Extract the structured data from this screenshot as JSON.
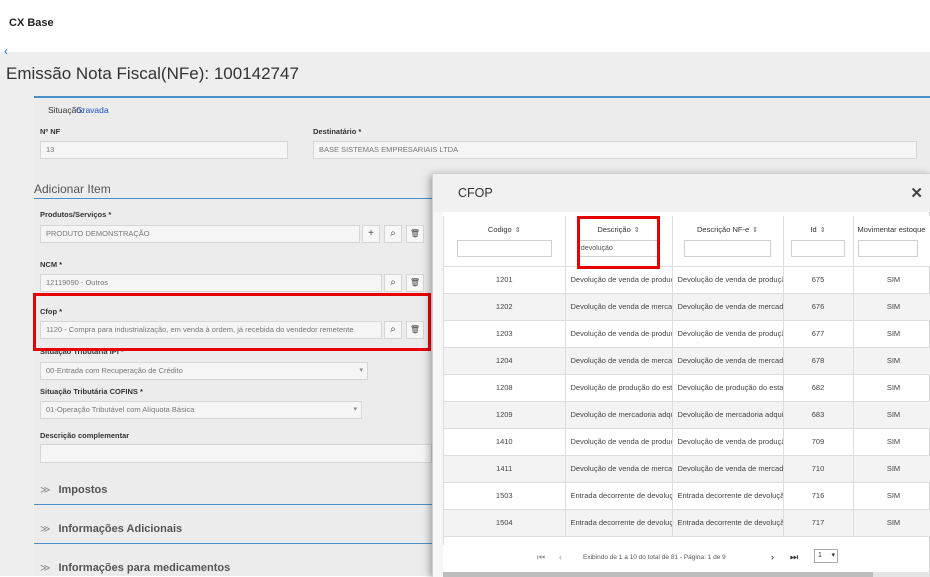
{
  "app": {
    "title": "CX Base",
    "back_glyph": "‹"
  },
  "page": {
    "title": "Emissão Nota Fiscal(NFe): 100142747"
  },
  "form": {
    "situacao_label": "Situação:",
    "situacao_value": "Gravada",
    "nf_label": "Nº NF",
    "nf_value": "13",
    "destinatario_label": "Destinatário *",
    "destinatario_value": "BASE SISTEMAS EMPRESARIAIS LTDA",
    "adicionar_item": "Adicionar Item",
    "produtos_label": "Produtos/Serviços *",
    "produtos_value": "PRODUTO DEMONSTRAÇÃO",
    "ncm_label": "NCM *",
    "ncm_value": "12119090 - Outros",
    "cfop_label": "Cfop *",
    "cfop_value": "1120 - Compra para industrialização, em venda à ordem, já recebida do vendedor remetente",
    "ipi_label": "Situação Tributária IPI *",
    "ipi_value": "00-Entrada com Recuperação de Crédito",
    "cofins_label": "Situação Tributária COFINS *",
    "cofins_value": "01-Operação Tributável com Alíquota Básica",
    "descricao_label": "Descrição complementar",
    "descricao_value": "",
    "sections": [
      "Impostos",
      "Informações Adicionais",
      "Informações para medicamentos"
    ]
  },
  "icons": {
    "plus": "+",
    "search": "⌕",
    "trash": "🗑",
    "chevron_section": "≫",
    "caret_down": "▾",
    "sort": "⇕"
  },
  "modal": {
    "title": "CFOP",
    "close_glyph": "✕",
    "columns": [
      "Codigo",
      "Descrição",
      "Descrição NF-e",
      "Id",
      "Movimentar estoque"
    ],
    "filters": [
      "",
      "devolução",
      "",
      "",
      ""
    ],
    "rows": [
      [
        "1201",
        "Devolução de venda de produção do estabelecimento",
        "Devolução de venda de produção do estabelecimento",
        "675",
        "SIM"
      ],
      [
        "1202",
        "Devolução de venda de mercadoria adquirida",
        "Devolução de venda de mercadoria adquirida",
        "676",
        "SIM"
      ],
      [
        "1203",
        "Devolução de venda de produção do estabelecimento",
        "Devolução de venda de produção do estabelecimento",
        "677",
        "SIM"
      ],
      [
        "1204",
        "Devolução de venda de mercadoria adquirida",
        "Devolução de venda de mercadoria adquirida",
        "678",
        "SIM"
      ],
      [
        "1208",
        "Devolução de produção do estabelecimento",
        "Devolução de produção do estabelecimento",
        "682",
        "SIM"
      ],
      [
        "1209",
        "Devolução de mercadoria adquirida",
        "Devolução de mercadoria adquirida",
        "683",
        "SIM"
      ],
      [
        "1410",
        "Devolução de venda de produção do estabelecimento",
        "Devolução de venda de produção do estabelecimento",
        "709",
        "SIM"
      ],
      [
        "1411",
        "Devolução de venda de mercadoria adquirida",
        "Devolução de venda de mercadoria adquirida",
        "710",
        "SIM"
      ],
      [
        "1503",
        "Entrada decorrente de devolução de produto",
        "Entrada decorrente de devolução de produto",
        "716",
        "SIM"
      ],
      [
        "1504",
        "Entrada decorrente de devolução de mercadoria",
        "Entrada decorrente de devolução de mercadoria",
        "717",
        "SIM"
      ]
    ],
    "pager": {
      "first": "⏮",
      "prev": "‹",
      "next": "›",
      "last": "⏭",
      "info": "Exibindo de 1 a 10 do total de 81 - Página: 1 de 9",
      "page_select": "1"
    }
  }
}
